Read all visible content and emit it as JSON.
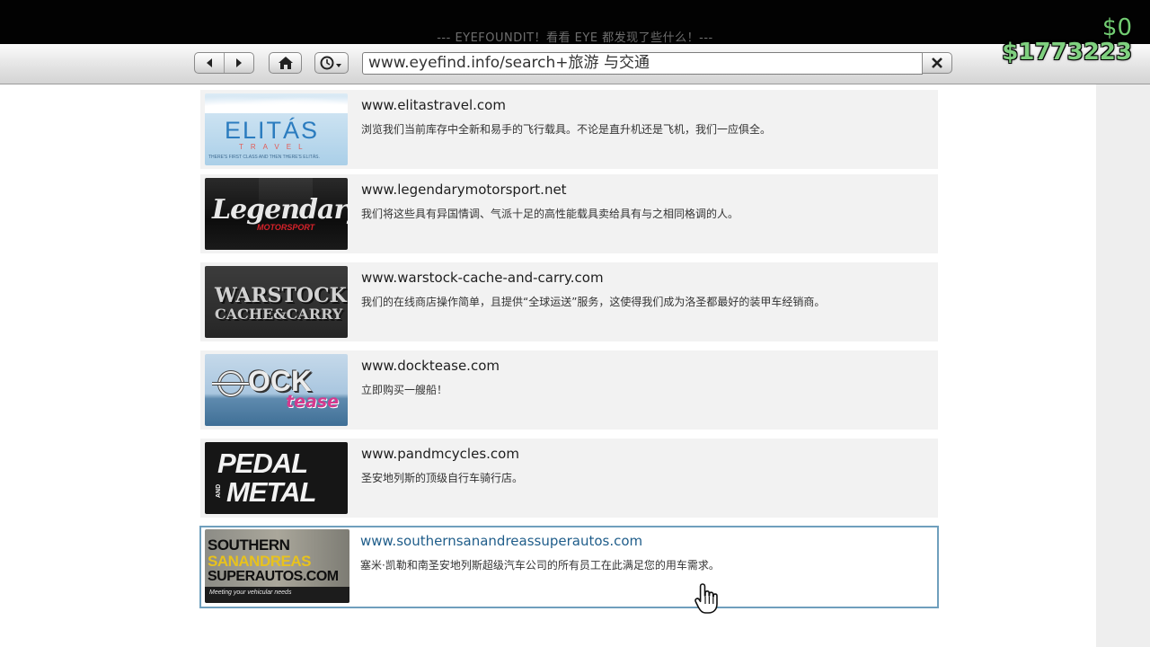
{
  "window": {
    "title": "--- EYEFOUNDIT！看看 EYE 都发现了些什么！---"
  },
  "toolbar": {
    "back_icon": "back-arrow-icon",
    "forward_icon": "forward-arrow-icon",
    "home_icon": "home-icon",
    "history_icon": "history-clock-icon",
    "url": "www.eyefind.info/search+旅游 与交通",
    "close_icon": "close-x-icon"
  },
  "hud": {
    "cash": "$0",
    "bank": "$1773223",
    "cash_color": "#72cc72"
  },
  "results": [
    {
      "url": "www.elitastravel.com",
      "desc": "浏览我们当前库存中全新和易手的飞行载具。不论是直升机还是飞机，我们一应俱全。",
      "logo": {
        "line1": "ELITÁS",
        "line2": "TRAVEL",
        "tagline": "THERE'S FIRST CLASS AND THEN THERE'S ELITÁS."
      }
    },
    {
      "url": "www.legendarymotorsport.net",
      "desc": "我们将这些具有异国情调、气派十足的高性能载具卖给具有与之相同格调的人。",
      "logo": {
        "line1": "Legendary",
        "line2": "MOTORSPORT"
      }
    },
    {
      "url": "www.warstock-cache-and-carry.com",
      "desc": "我们的在线商店操作简单，且提供“全球运送”服务，这使得我们成为洛圣都最好的装甲车经销商。",
      "logo": {
        "line1": "WARSTOCK",
        "line2": "CACHE&CARRY"
      }
    },
    {
      "url": "www.docktease.com",
      "desc": "立即购买一艘船！",
      "logo": {
        "line1": "OCK",
        "line2": "tease"
      }
    },
    {
      "url": "www.pandmcycles.com",
      "desc": "圣安地列斯的顶级自行车骑行店。",
      "logo": {
        "line1": "PEDAL",
        "line2": "METAL",
        "and": "AND"
      }
    },
    {
      "url": "www.southernsanandreassuperautos.com",
      "desc": "塞米·凯勒和南圣安地列斯超级汽车公司的所有员工在此满足您的用车需求。",
      "logo": {
        "line1": "SOUTHERN",
        "line2": "SANANDREAS",
        "line3": "SUPERAUTOS.COM",
        "tagline": "Meeting your vehicular needs"
      }
    }
  ],
  "cursor_icon": "hand-pointer-icon"
}
